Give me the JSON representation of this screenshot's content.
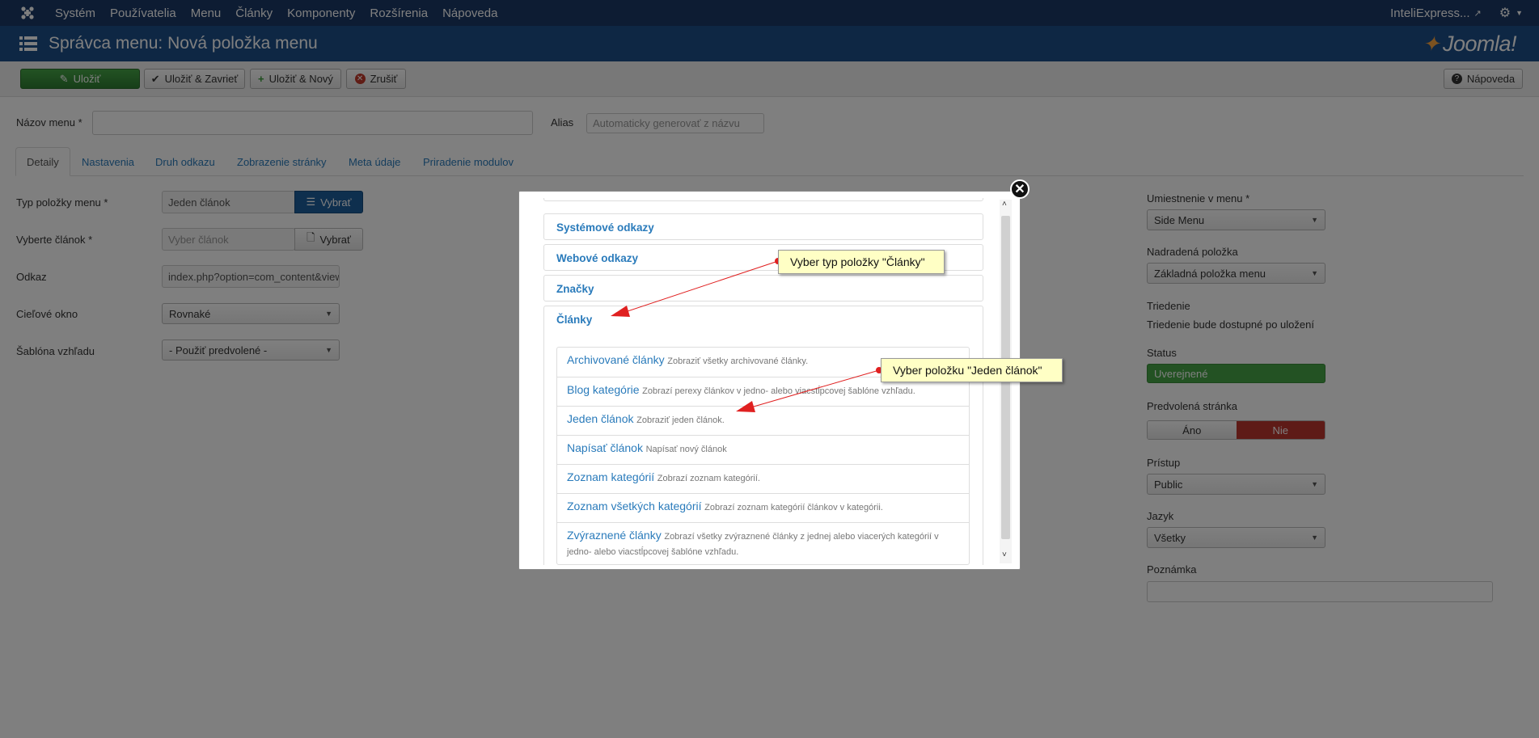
{
  "topnav": {
    "items": [
      "Systém",
      "Používatelia",
      "Menu",
      "Články",
      "Komponenty",
      "Rozšírenia",
      "Nápoveda"
    ],
    "user_label": "InteliExpress..."
  },
  "header": {
    "title": "Správca menu: Nová položka menu",
    "brand": "Joomla!"
  },
  "toolbar": {
    "save": "Uložiť",
    "save_close": "Uložiť & Zavrieť",
    "save_new": "Uložiť & Nový",
    "cancel": "Zrušiť",
    "help": "Nápoveda"
  },
  "form": {
    "title_label": "Názov menu *",
    "title_value": "",
    "alias_label": "Alias",
    "alias_placeholder": "Automaticky generovať z názvu"
  },
  "tabs": [
    "Detaily",
    "Nastavenia",
    "Druh odkazu",
    "Zobrazenie stránky",
    "Meta údaje",
    "Priradenie modulov"
  ],
  "details": {
    "menu_type_label": "Typ položky menu *",
    "menu_type_value": "Jeden článok",
    "select_label": "Vybrať",
    "article_label": "Vyberte článok *",
    "article_placeholder": "Vyber článok",
    "link_label": "Odkaz",
    "link_value": "index.php?option=com_content&view=article",
    "target_label": "Cieľové okno",
    "target_value": "Rovnaké",
    "template_label": "Šablóna vzhľadu",
    "template_value": "- Použiť predvolené -"
  },
  "sidebar": {
    "menu_location_label": "Umiestnenie v menu *",
    "menu_location_value": "Side Menu",
    "parent_label": "Nadradená položka",
    "parent_value": "Základná položka menu",
    "ordering_label": "Triedenie",
    "ordering_text": "Triedenie bude dostupné po uložení",
    "status_label": "Status",
    "status_value": "Uverejnené",
    "default_label": "Predvolená stránka",
    "yes": "Áno",
    "no": "Nie",
    "access_label": "Prístup",
    "access_value": "Public",
    "language_label": "Jazyk",
    "language_value": "Všetky",
    "note_label": "Poznámka"
  },
  "modal": {
    "groups": [
      "Systémové odkazy",
      "Webové odkazy",
      "Značky",
      "Články"
    ],
    "items": [
      {
        "title": "Archivované články",
        "desc": "Zobraziť všetky archivované články."
      },
      {
        "title": "Blog kategórie",
        "desc": "Zobrazí perexy článkov v jedno- alebo viacstĺpcovej šablóne vzhľadu."
      },
      {
        "title": "Jeden článok",
        "desc": "Zobraziť jeden článok."
      },
      {
        "title": "Napísať článok",
        "desc": "Napísať nový článok"
      },
      {
        "title": "Zoznam kategórií",
        "desc": "Zobrazí zoznam kategórií."
      },
      {
        "title": "Zoznam všetkých kategórií",
        "desc": "Zobrazí zoznam kategórií článkov v kategórii."
      },
      {
        "title": "Zvýraznené články",
        "desc": "Zobrazí všetky zvýraznené články z jednej alebo viacerých kategórií v jedno- alebo viacstĺpcovej šablóne vzhľadu."
      }
    ],
    "callout_1": "Vyber typ položky \"Články\"",
    "callout_2": "Vyber položku \"Jeden článok\""
  },
  "colors": {
    "nav_dark": "#1a3867",
    "header_blue": "#1d4e89",
    "green": "#46a546",
    "red": "#bd362f",
    "link": "#2a7bbb",
    "callout": "#ffffc5"
  }
}
